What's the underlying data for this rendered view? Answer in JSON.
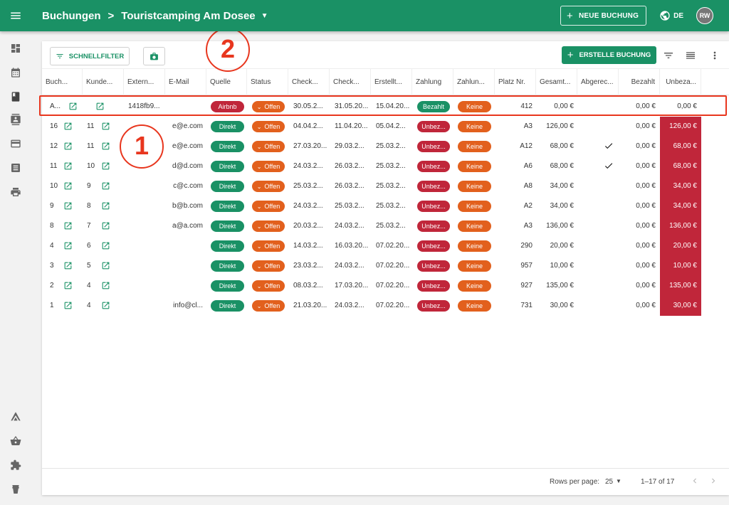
{
  "header": {
    "breadcrumb_root": "Buchungen",
    "breadcrumb_separator": ">",
    "breadcrumb_current": "Touristcamping Am Dosee",
    "new_booking_label": "NEUE BUCHUNG",
    "language": "DE",
    "avatar_initials": "RW"
  },
  "sidebar": {
    "icons": [
      "dashboard-icon",
      "calendar-icon",
      "book-icon",
      "contacts-icon",
      "credit-card-icon",
      "list-icon",
      "printer-icon",
      "tent-icon",
      "basket-icon",
      "puzzle-icon",
      "cup-icon"
    ]
  },
  "toolbar": {
    "quick_filter_label": "SCHNELLFILTER",
    "create_booking_label": "ERSTELLE BUCHUNG"
  },
  "table": {
    "columns": [
      "Buch...",
      "Kunde...",
      "Extern...",
      "E-Mail",
      "Quelle",
      "Status",
      "Check...",
      "Check...",
      "Erstellt...",
      "Zahlung",
      "Zahlun...",
      "Platz Nr.",
      "Gesamt...",
      "Abgerec...",
      "Bezahlt",
      "Unbeza..."
    ],
    "rows": [
      {
        "id": "A...",
        "customer": "",
        "external": "1418fb9...",
        "email": "",
        "source": "Airbnb",
        "status": "Offen",
        "checkin": "30.05.2...",
        "checkout": "31.05.20...",
        "created": "15.04.20...",
        "payment": "Bezahlt",
        "payment_status": "Keine",
        "site": "412",
        "total": "0,00 €",
        "settled": false,
        "paid": "0,00 €",
        "unpaid": "0,00 €"
      },
      {
        "id": "16",
        "customer": "11",
        "external": "",
        "email": "e@e.com",
        "source": "Direkt",
        "status": "Offen",
        "checkin": "04.04.2...",
        "checkout": "11.04.20...",
        "created": "05.04.2...",
        "payment": "Unbez...",
        "payment_status": "Keine",
        "site": "A3",
        "total": "126,00 €",
        "settled": false,
        "paid": "0,00 €",
        "unpaid": "126,00 €"
      },
      {
        "id": "12",
        "customer": "11",
        "external": "",
        "email": "e@e.com",
        "source": "Direkt",
        "status": "Offen",
        "checkin": "27.03.20...",
        "checkout": "29.03.2...",
        "created": "25.03.2...",
        "payment": "Unbez...",
        "payment_status": "Keine",
        "site": "A12",
        "total": "68,00 €",
        "settled": true,
        "paid": "0,00 €",
        "unpaid": "68,00 €"
      },
      {
        "id": "11",
        "customer": "10",
        "external": "",
        "email": "d@d.com",
        "source": "Direkt",
        "status": "Offen",
        "checkin": "24.03.2...",
        "checkout": "26.03.2...",
        "created": "25.03.2...",
        "payment": "Unbez...",
        "payment_status": "Keine",
        "site": "A6",
        "total": "68,00 €",
        "settled": true,
        "paid": "0,00 €",
        "unpaid": "68,00 €"
      },
      {
        "id": "10",
        "customer": "9",
        "external": "",
        "email": "c@c.com",
        "source": "Direkt",
        "status": "Offen",
        "checkin": "25.03.2...",
        "checkout": "26.03.2...",
        "created": "25.03.2...",
        "payment": "Unbez...",
        "payment_status": "Keine",
        "site": "A8",
        "total": "34,00 €",
        "settled": false,
        "paid": "0,00 €",
        "unpaid": "34,00 €"
      },
      {
        "id": "9",
        "customer": "8",
        "external": "",
        "email": "b@b.com",
        "source": "Direkt",
        "status": "Offen",
        "checkin": "24.03.2...",
        "checkout": "25.03.2...",
        "created": "25.03.2...",
        "payment": "Unbez...",
        "payment_status": "Keine",
        "site": "A2",
        "total": "34,00 €",
        "settled": false,
        "paid": "0,00 €",
        "unpaid": "34,00 €"
      },
      {
        "id": "8",
        "customer": "7",
        "external": "",
        "email": "a@a.com",
        "source": "Direkt",
        "status": "Offen",
        "checkin": "20.03.2...",
        "checkout": "24.03.2...",
        "created": "25.03.2...",
        "payment": "Unbez...",
        "payment_status": "Keine",
        "site": "A3",
        "total": "136,00 €",
        "settled": false,
        "paid": "0,00 €",
        "unpaid": "136,00 €"
      },
      {
        "id": "4",
        "customer": "6",
        "external": "",
        "email": "",
        "source": "Direkt",
        "status": "Offen",
        "checkin": "14.03.2...",
        "checkout": "16.03.20...",
        "created": "07.02.20...",
        "payment": "Unbez...",
        "payment_status": "Keine",
        "site": "290",
        "total": "20,00 €",
        "settled": false,
        "paid": "0,00 €",
        "unpaid": "20,00 €"
      },
      {
        "id": "3",
        "customer": "5",
        "external": "",
        "email": "",
        "source": "Direkt",
        "status": "Offen",
        "checkin": "23.03.2...",
        "checkout": "24.03.2...",
        "created": "07.02.20...",
        "payment": "Unbez...",
        "payment_status": "Keine",
        "site": "957",
        "total": "10,00 €",
        "settled": false,
        "paid": "0,00 €",
        "unpaid": "10,00 €"
      },
      {
        "id": "2",
        "customer": "4",
        "external": "",
        "email": "",
        "source": "Direkt",
        "status": "Offen",
        "checkin": "08.03.2...",
        "checkout": "17.03.20...",
        "created": "07.02.20...",
        "payment": "Unbez...",
        "payment_status": "Keine",
        "site": "927",
        "total": "135,00 €",
        "settled": false,
        "paid": "0,00 €",
        "unpaid": "135,00 €"
      },
      {
        "id": "1",
        "customer": "4",
        "external": "",
        "email": "info@cl...",
        "source": "Direkt",
        "status": "Offen",
        "checkin": "21.03.20...",
        "checkout": "24.03.2...",
        "created": "07.02.20...",
        "payment": "Unbez...",
        "payment_status": "Keine",
        "site": "731",
        "total": "30,00 €",
        "settled": false,
        "paid": "0,00 €",
        "unpaid": "30,00 €"
      }
    ]
  },
  "footer": {
    "rows_per_page_label": "Rows per page:",
    "rows_per_page_value": "25",
    "page_range": "1–17 of 17"
  },
  "annotations": {
    "callout_1": "1",
    "callout_2": "2"
  },
  "colors": {
    "brand_green": "#1a9165",
    "alert_red": "#c0263a",
    "warning_orange": "#e2601d",
    "annotation_red": "#e8361e"
  }
}
